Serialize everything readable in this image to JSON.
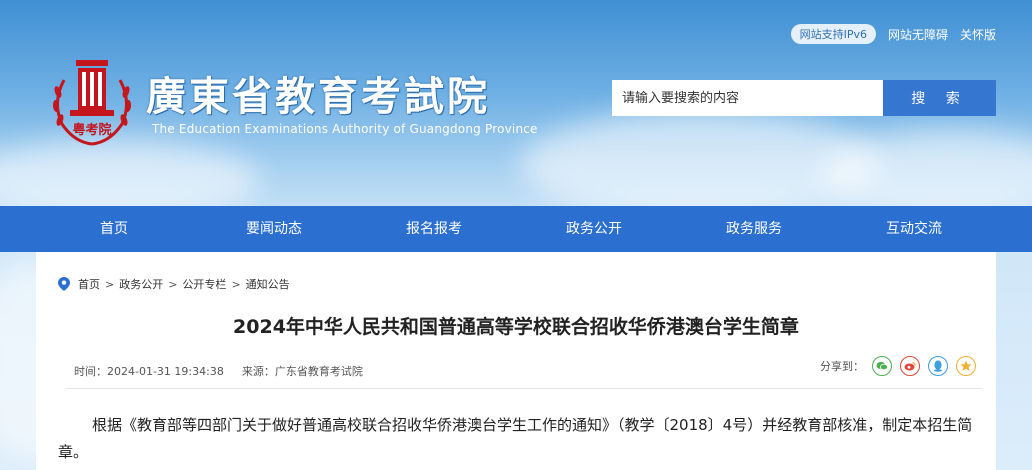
{
  "top_links": {
    "ipv6": "网站支持IPv6",
    "accessibility": "网站无障碍",
    "care_mode": "关怀版"
  },
  "brand": {
    "name_cn": "廣東省教育考試院",
    "name_en": "The Education Examinations Authority of Guangdong Province",
    "logo_text": "粤考院"
  },
  "search": {
    "placeholder": "请输入要搜索的内容",
    "button": "搜  索"
  },
  "nav": [
    "首页",
    "要闻动态",
    "报名报考",
    "政务公开",
    "政务服务",
    "互动交流"
  ],
  "breadcrumb": [
    "首页",
    "政务公开",
    "公开专栏",
    "通知公告"
  ],
  "article": {
    "title": "2024年中华人民共和国普通高等学校联合招收华侨港澳台学生简章",
    "time": "时间：2024-01-31 19:34:38",
    "source": "来源：广东省教育考试院",
    "share_label": "分享到：",
    "body": "根据《教育部等四部门关于做好普通高校联合招收华侨港澳台学生工作的通知》（教学〔2018〕4号）并经教育部核准，制定本招生简章。"
  },
  "share_icons": [
    "wechat-icon",
    "weibo-icon",
    "qq-icon",
    "qzone-icon"
  ],
  "colors": {
    "nav": "#2b6fd0",
    "search_button": "#3576d0",
    "logo_red": "#c4161c"
  }
}
